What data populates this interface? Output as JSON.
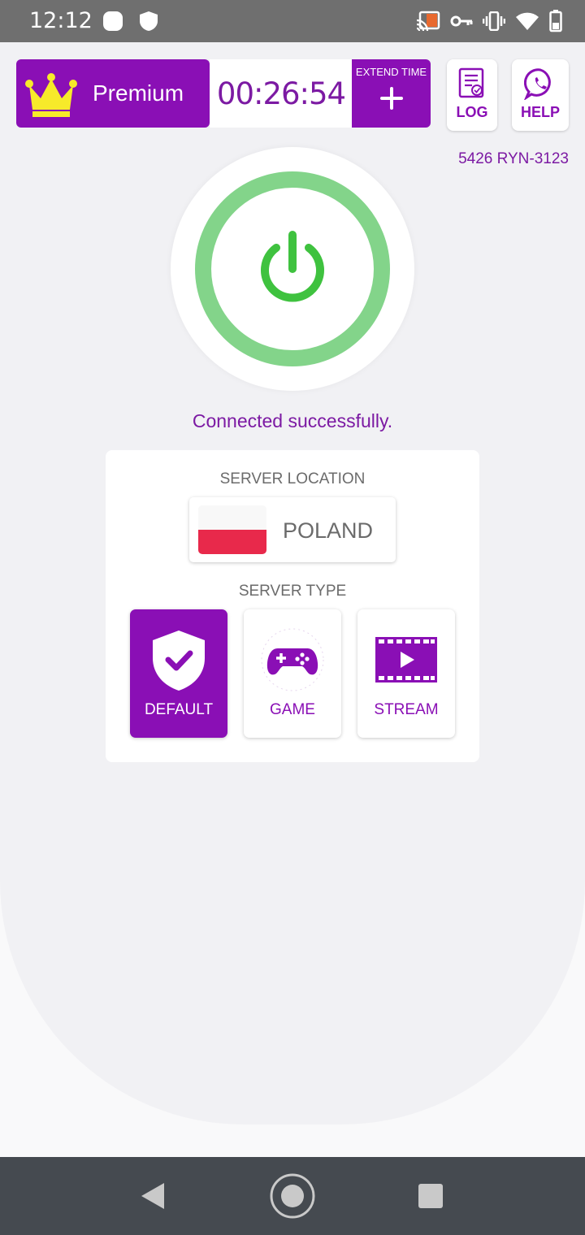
{
  "status_bar": {
    "time": "12:12"
  },
  "header": {
    "premium_label": "Premium",
    "timer": "00:26:54",
    "extend_label": "EXTEND TIME",
    "log_label": "LOG",
    "help_label": "HELP",
    "user_id": "5426  RYN-3123"
  },
  "connection": {
    "status_text": "Connected successfully."
  },
  "server": {
    "location_heading": "SERVER LOCATION",
    "country": "POLAND",
    "type_heading": "SERVER TYPE",
    "types": [
      {
        "label": "DEFAULT",
        "icon": "shield-check-icon",
        "selected": true
      },
      {
        "label": "GAME",
        "icon": "gamepad-icon",
        "selected": false
      },
      {
        "label": "STREAM",
        "icon": "film-play-icon",
        "selected": false
      }
    ]
  },
  "colors": {
    "brand": "#8a0fb5",
    "connected": "#3fc23f",
    "ring": "#83d48a"
  }
}
